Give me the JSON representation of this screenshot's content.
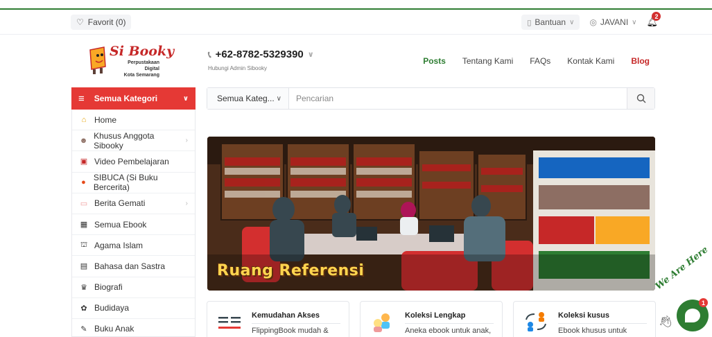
{
  "topbar": {
    "favorit_label": "Favorit (0)",
    "help_label": "Bantuan",
    "user_label": "JAVANI",
    "notification_count": "2"
  },
  "header": {
    "logo_name": "Si Booky",
    "logo_sub1": "Perpustakaan Digital",
    "logo_sub2": "Kota Semarang",
    "phone": "+62-8782-5329390",
    "phone_caption": "Hubungi Admin Sibooky",
    "nav": [
      "Posts",
      "Tentang Kami",
      "FAQs",
      "Kontak Kami",
      "Blog"
    ]
  },
  "category_bar": {
    "label": "Semua Kategori"
  },
  "search": {
    "category_value": "Semua Kateg...",
    "placeholder": "Pencarian"
  },
  "sidebar": {
    "items": [
      {
        "label": "Home",
        "icon": "home-icon",
        "submenu": false
      },
      {
        "label": "Khusus Anggota Sibooky",
        "icon": "members-icon",
        "submenu": true
      },
      {
        "label": "Video Pembelajaran",
        "icon": "video-icon",
        "submenu": false
      },
      {
        "label": "SIBUCA (Si Buku Bercerita)",
        "icon": "story-icon",
        "submenu": false
      },
      {
        "label": "Berita Gemati",
        "icon": "news-icon",
        "submenu": true
      },
      {
        "label": "Semua Ebook",
        "icon": "ebook-icon",
        "submenu": false
      },
      {
        "label": "Agama Islam",
        "icon": "mosque-icon",
        "submenu": false
      },
      {
        "label": "Bahasa dan Sastra",
        "icon": "language-icon",
        "submenu": false
      },
      {
        "label": "Biografi",
        "icon": "person-icon",
        "submenu": false
      },
      {
        "label": "Budidaya",
        "icon": "plant-icon",
        "submenu": false
      },
      {
        "label": "Buku Anak",
        "icon": "children-book-icon",
        "submenu": false
      }
    ]
  },
  "banner": {
    "title": "Ruang Referensi"
  },
  "features": [
    {
      "title": "Kemudahan Akses",
      "desc": "FlippingBook mudah &"
    },
    {
      "title": "Koleksi Lengkap",
      "desc": "Aneka ebook untuk anak,"
    },
    {
      "title": "Koleksi kusus",
      "desc": "Ebook khusus untuk"
    }
  ],
  "chat": {
    "text": "We Are Here",
    "badge": "1"
  },
  "colors": {
    "brand_green": "#2e7d32",
    "brand_red": "#e53935"
  }
}
